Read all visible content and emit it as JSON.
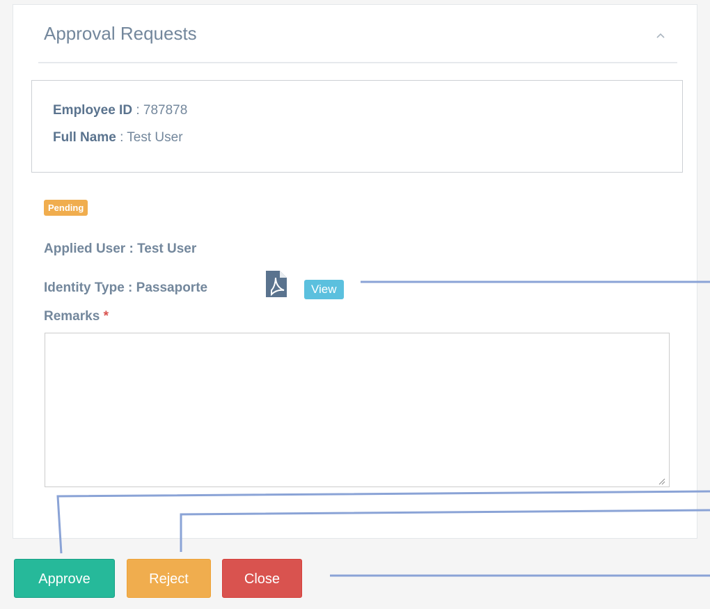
{
  "panel": {
    "title": "Approval Requests",
    "collapse_icon": "chevron-up-icon"
  },
  "employee": {
    "id_label": "Employee ID",
    "id_value": ": 787878",
    "name_label": "Full Name",
    "name_value": ": Test User"
  },
  "request": {
    "status": "Pending",
    "status_color": "#f0ad4e",
    "applied_user": "Applied User : Test User",
    "identity_type": "Identity Type : Passaporte",
    "document_icon": "pdf-file-icon",
    "view_label": "View",
    "remarks_label": "Remarks",
    "remarks_required": "*",
    "remarks_value": ""
  },
  "actions": {
    "approve_label": "Approve",
    "reject_label": "Reject",
    "close_label": "Close"
  },
  "colors": {
    "approve": "#26b99a",
    "reject": "#f0ad4e",
    "close": "#d9534f",
    "view": "#5bc0de",
    "callout": "#8aa3d6"
  }
}
